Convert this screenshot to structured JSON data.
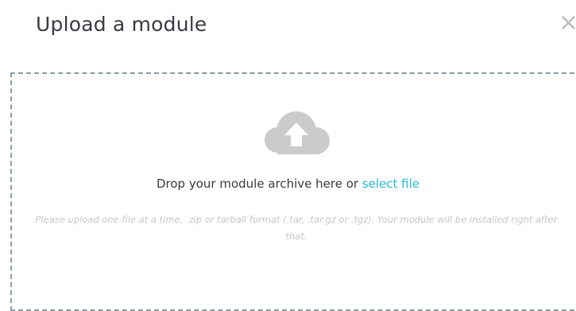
{
  "modal": {
    "title": "Upload a module",
    "close_label": "×"
  },
  "dropzone": {
    "icon": "cloud-upload-icon",
    "prompt_text": "Drop your module archive here or ",
    "select_file_label": "select file",
    "hint": "Please upload one file at a time, .zip or tarball format (.tar, .tar.gz or .tgz). Your module will be installed right after that."
  },
  "colors": {
    "title": "#363a41",
    "link": "#25b9d7",
    "hint": "#c3c7cb",
    "dashed_border": "#8a9aa5",
    "icon": "#cbcbcb"
  }
}
